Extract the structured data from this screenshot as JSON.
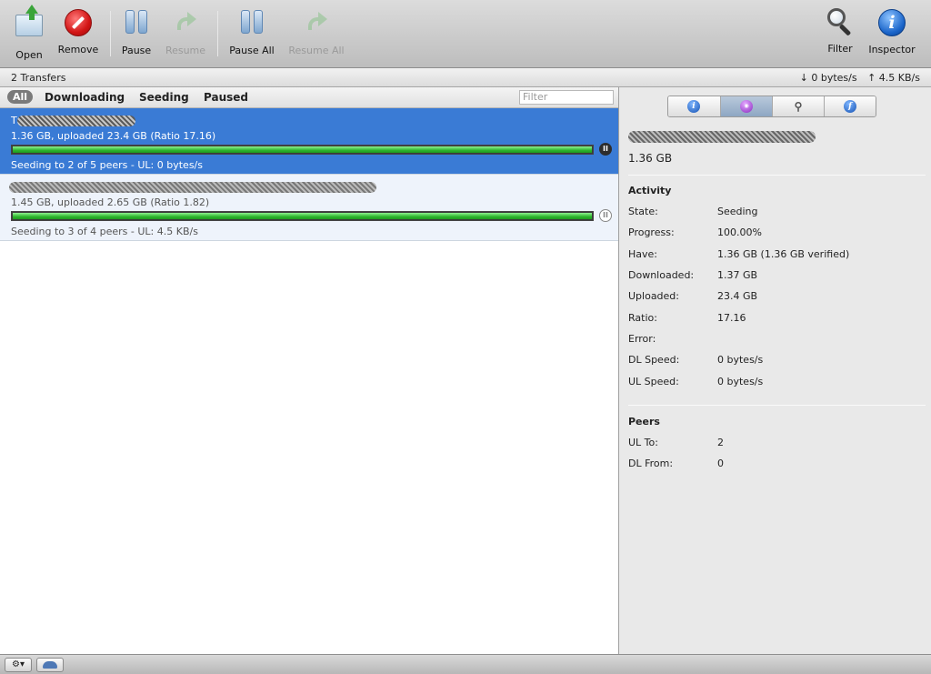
{
  "toolbar": {
    "open": "Open",
    "remove": "Remove",
    "pause": "Pause",
    "resume": "Resume",
    "pause_all": "Pause All",
    "resume_all": "Resume All",
    "filter": "Filter",
    "inspector": "Inspector"
  },
  "statusbar": {
    "transfers": "2 Transfers",
    "download_rate": "↓ 0 bytes/s",
    "upload_rate": "↑ 4.5 KB/s"
  },
  "filterbar": {
    "all": "All",
    "downloading": "Downloading",
    "seeding": "Seeding",
    "paused": "Paused",
    "search_placeholder": "Filter"
  },
  "torrents": [
    {
      "name_visible": "T",
      "info": "1.36 GB, uploaded 23.4 GB (Ratio 17.16)",
      "progress": 1.0,
      "status": "Seeding to 2 of 5 peers - UL: 0 bytes/s",
      "selected": true
    },
    {
      "name_visible": "",
      "info": "1.45 GB, uploaded 2.65 GB (Ratio 1.82)",
      "progress": 1.0,
      "status": "Seeding to 3 of 4 peers - UL: 4.5 KB/s",
      "selected": false
    }
  ],
  "inspector": {
    "tabs": [
      "info-icon",
      "activity-icon",
      "peers-icon",
      "files-icon"
    ],
    "active_tab": "activity-icon",
    "size": "1.36 GB",
    "activity_title": "Activity",
    "activity": [
      {
        "label": "State:",
        "value": "Seeding"
      },
      {
        "label": "Progress:",
        "value": "100.00%"
      },
      {
        "label": "Have:",
        "value": "1.36 GB (1.36 GB verified)"
      },
      {
        "label": "Downloaded:",
        "value": "1.37 GB"
      },
      {
        "label": "Uploaded:",
        "value": "23.4 GB"
      },
      {
        "label": "Ratio:",
        "value": "17.16"
      },
      {
        "label": "Error:",
        "value": ""
      },
      {
        "label": "DL Speed:",
        "value": "0 bytes/s"
      },
      {
        "label": "UL Speed:",
        "value": "0 bytes/s"
      }
    ],
    "peers_title": "Peers",
    "peers": [
      {
        "label": "UL To:",
        "value": "2"
      },
      {
        "label": "DL From:",
        "value": "0"
      }
    ]
  },
  "colors": {
    "selection": "#3a7bd5",
    "progress_green": "#2db52d"
  }
}
